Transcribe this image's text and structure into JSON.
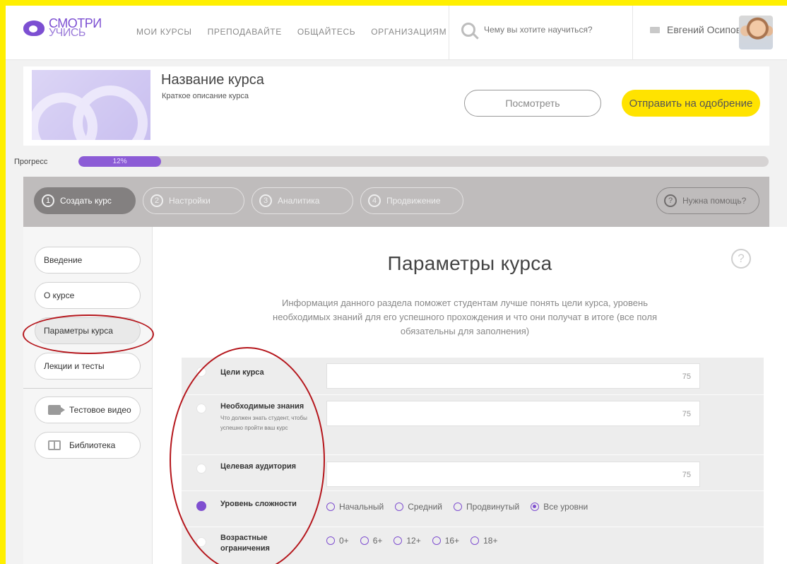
{
  "header": {
    "logo_line1": "СМОТРИ",
    "logo_line2": "УЧИСЬ",
    "nav": [
      "МОИ КУРСЫ",
      "ПРЕПОДАВАЙТЕ",
      "ОБЩАЙТЕСЬ",
      "ОРГАНИЗАЦИЯМ"
    ],
    "search_placeholder": "Чему вы хотите научиться?",
    "user_name": "Евгений Осипов"
  },
  "course": {
    "title": "Название курса",
    "description": "Краткое описание курса",
    "view_button": "Посмотреть",
    "submit_button": "Отправить на одобрение"
  },
  "progress": {
    "label": "Прогресс",
    "value_text": "12%",
    "value": 12
  },
  "steps": [
    {
      "num": "1",
      "label": "Создать курс"
    },
    {
      "num": "2",
      "label": "Настройки"
    },
    {
      "num": "3",
      "label": "Аналитика"
    },
    {
      "num": "4",
      "label": "Продвижение"
    }
  ],
  "help_step": {
    "num": "?",
    "label": "Нужна помощь?"
  },
  "sidebar": {
    "items": [
      "Введение",
      "О курсе",
      "Параметры курса",
      "Лекции и тесты"
    ],
    "tools": [
      "Тестовое видео",
      "Библиотека"
    ]
  },
  "main": {
    "title": "Параметры курса",
    "help": "?",
    "description": "Информация данного раздела поможет студентам лучше понять цели курса, уровень необходимых знаний для его успешного прохождения и что они получат в итоге (все поля обязательны для заполнения)"
  },
  "form": {
    "goals": {
      "label": "Цели курса",
      "count": "75"
    },
    "knowledge": {
      "label": "Необходимые знания",
      "hint": "Что должен знать студент, чтобы успешно пройти ваш курс",
      "count": "75"
    },
    "audience": {
      "label": "Целевая аудитория",
      "count": "75"
    },
    "level": {
      "label": "Уровень сложности",
      "options": [
        "Начальный",
        "Средний",
        "Продвинутый",
        "Все уровни"
      ],
      "selected": "Все уровни"
    },
    "age": {
      "label": "Возрастные ограничения",
      "options": [
        "0+",
        "6+",
        "12+",
        "16+",
        "18+"
      ]
    }
  },
  "colors": {
    "accent": "#7f4fd0",
    "yellow": "#ffe300",
    "annotation": "#b5161c"
  }
}
